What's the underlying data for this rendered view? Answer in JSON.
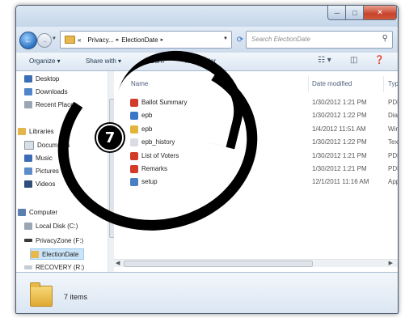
{
  "address": {
    "crumbs": [
      "«",
      "Privacy...",
      "ElectionDate"
    ],
    "search_placeholder": "Search ElectionDate"
  },
  "toolbar": {
    "organize": "Organize ▾",
    "share_with": "Share with ▾",
    "burn": "Burn",
    "new_folder": "New folder"
  },
  "nav": {
    "desktop": "Desktop",
    "downloads": "Downloads",
    "recent_places": "Recent Places",
    "libraries": "Libraries",
    "documents": "Documents",
    "music": "Music",
    "pictures": "Pictures",
    "videos": "Videos",
    "computer": "Computer",
    "local_disk": "Local Disk (C:)",
    "privacyzone": "PrivacyZone (F:)",
    "electiondate": "ElectionDate",
    "recovery": "RECOVERY (R:)"
  },
  "columns": {
    "name": "Name",
    "date_modified": "Date modified",
    "type": "Type"
  },
  "files": [
    {
      "name": "Ballot Summary",
      "date": "1/30/2012 1:21 PM",
      "type": "PDF Co",
      "icon": "pdf-icon",
      "color": "#d23a2a"
    },
    {
      "name": "epb",
      "date": "1/30/2012 1:22 PM",
      "type": "Dial-Up",
      "icon": "dialup-icon",
      "color": "#3a77c8"
    },
    {
      "name": "epb",
      "date": "1/4/2012 11:51 AM",
      "type": "WinZip",
      "icon": "zip-icon",
      "color": "#e2b53a"
    },
    {
      "name": "epb_history",
      "date": "1/30/2012 1:22 PM",
      "type": "Text D",
      "icon": "text-file-icon",
      "color": "#d9dde3"
    },
    {
      "name": "List of Voters",
      "date": "1/30/2012 1:21 PM",
      "type": "PDF Co",
      "icon": "pdf-icon",
      "color": "#d23a2a"
    },
    {
      "name": "Remarks",
      "date": "1/30/2012 1:21 PM",
      "type": "PDF Co",
      "icon": "pdf-icon",
      "color": "#d23a2a"
    },
    {
      "name": "setup",
      "date": "12/1/2011 11:16 AM",
      "type": "Applica",
      "icon": "setup-icon",
      "color": "#4b7fc4"
    }
  ],
  "status": {
    "items_count": "7 items"
  },
  "annotation": {
    "step_number": "7"
  }
}
